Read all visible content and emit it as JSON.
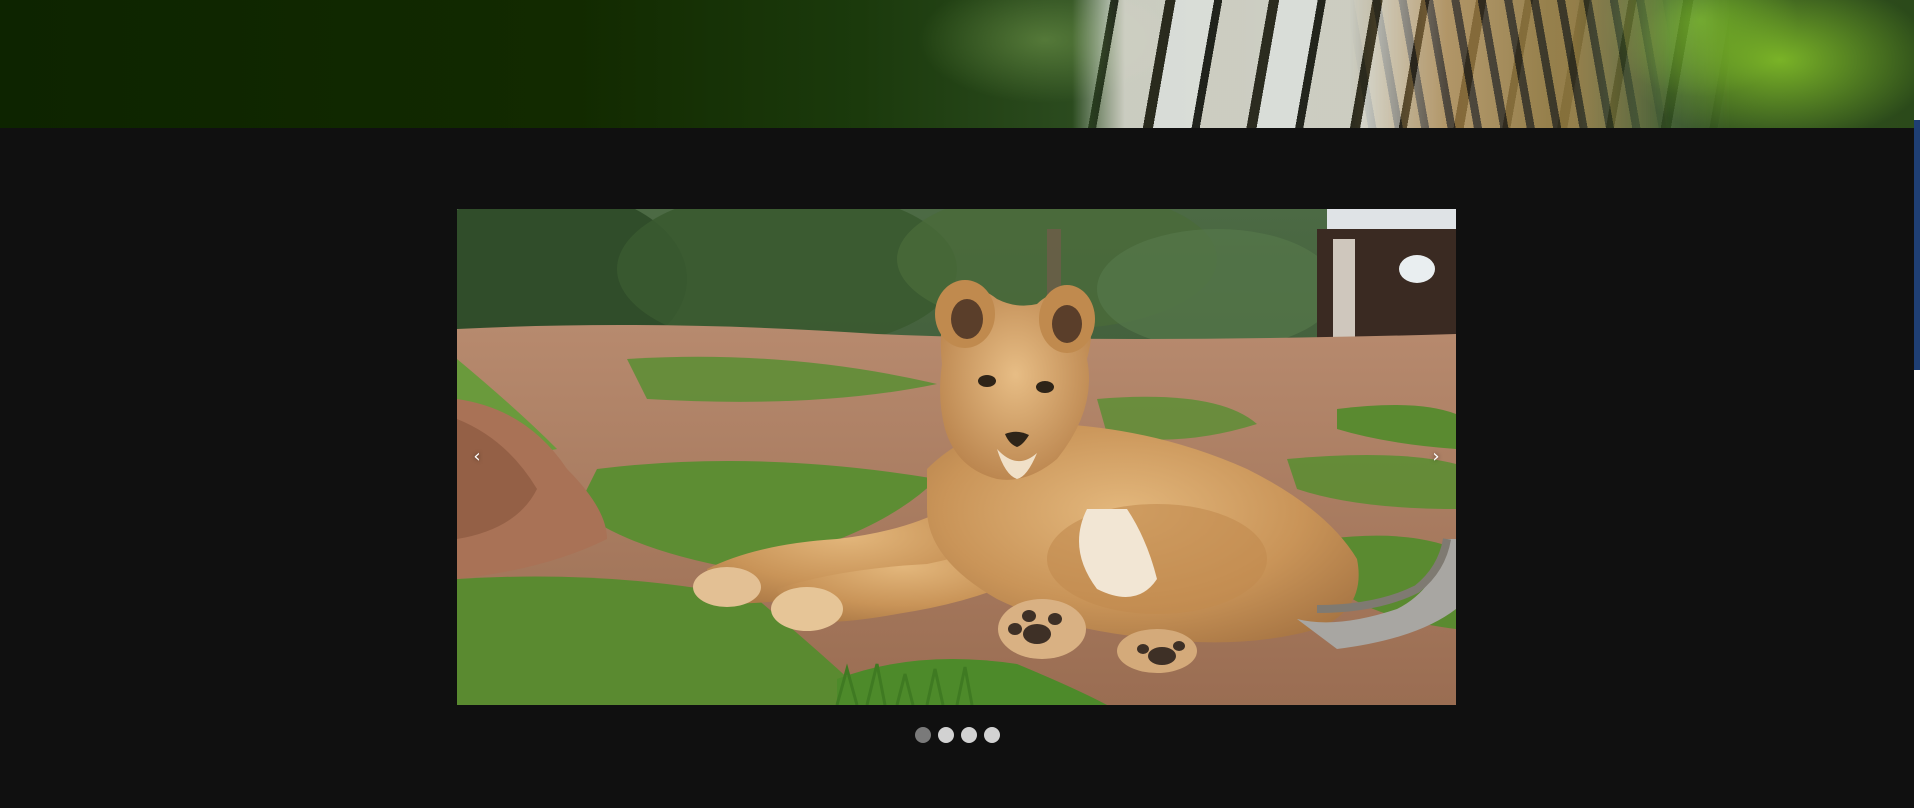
{
  "hero": {
    "image": "tiger-in-foliage-banner"
  },
  "carousel": {
    "slide": {
      "image": "lion-cub-lying-on-grass"
    },
    "prev_glyph": "‹",
    "next_glyph": "›",
    "indicators": [
      {
        "active": true
      },
      {
        "active": false
      },
      {
        "active": false
      },
      {
        "active": false
      }
    ],
    "current_slide": 1,
    "slide_count": 4
  },
  "colors": {
    "page_background": "#101010",
    "indicator_active": "#7a7a7a",
    "indicator_inactive": "#d2d2d2",
    "scroll_accent": "#1f3f74"
  }
}
